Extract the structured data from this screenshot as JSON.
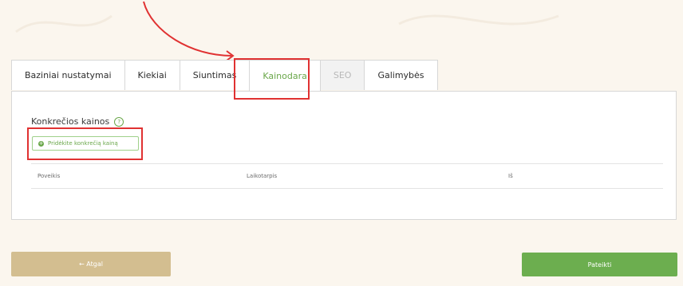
{
  "tabs": [
    {
      "label": "Baziniai nustatymai",
      "state": "normal"
    },
    {
      "label": "Kiekiai",
      "state": "normal"
    },
    {
      "label": "Siuntimas",
      "state": "normal"
    },
    {
      "label": "Kainodara",
      "state": "active"
    },
    {
      "label": "SEO",
      "state": "disabled"
    },
    {
      "label": "Galimybės",
      "state": "normal"
    }
  ],
  "section": {
    "title": "Konkrečios kainos",
    "help_icon": "help-icon",
    "add_button_label": "Pridėkite konkrečią kainą",
    "add_icon": "plus-icon"
  },
  "table": {
    "columns": [
      "Poveikis",
      "Laikotarpis",
      "Iš"
    ]
  },
  "footer": {
    "back_label": "← Atgal",
    "submit_label": "Pateikti"
  },
  "colors": {
    "accent": "#6aa74a",
    "annotation": "#e03232",
    "back_button": "#d3be90",
    "submit_button": "#6cae4f"
  }
}
